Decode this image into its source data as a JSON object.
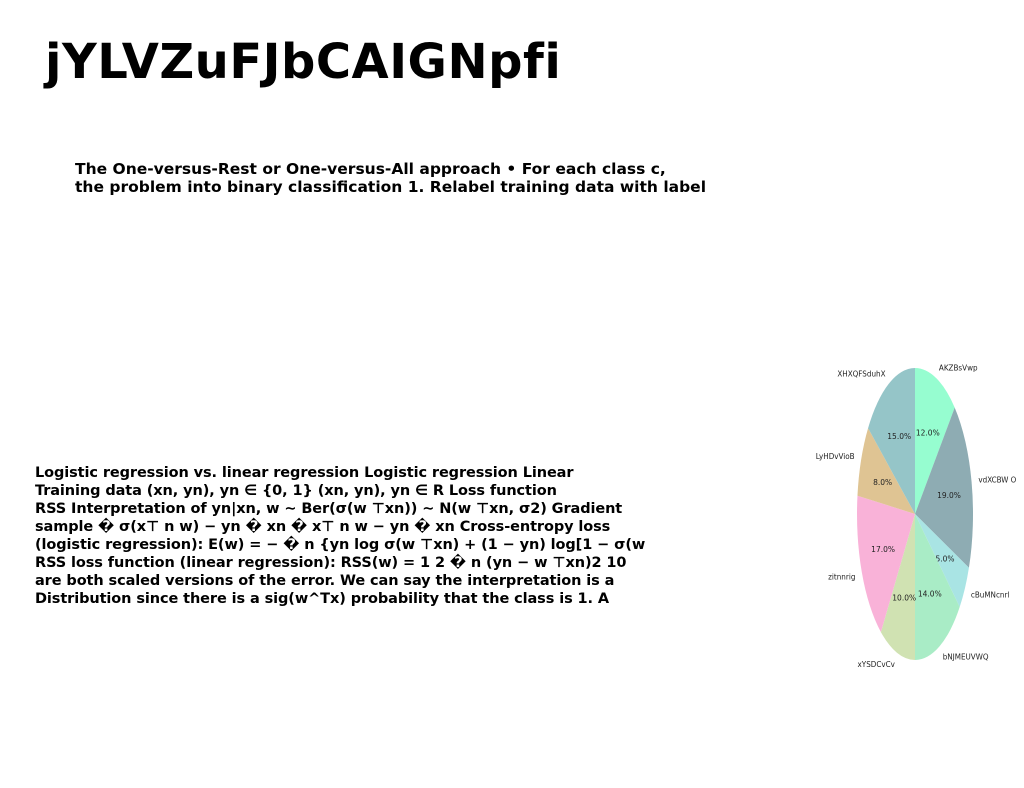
{
  "slide": {
    "title": "jYLVZuFJbCAIGNpfi",
    "intro_lines": [
      "The One-versus-Rest or One-versus-All approach • For each class c,",
      "the problem into binary classification 1. Relabel training data with label"
    ],
    "body_lines": [
      "Logistic regression vs. linear regression Logistic regression Linear",
      "Training data (xn, yn), yn ∈ {0, 1} (xn, yn), yn ∈ R Loss function",
      "RSS Interpretation of yn|xn, w ∼ Ber(σ(w ⊤xn)) ∼ N(w ⊤xn, σ2) Gradient",
      "sample � σ(x⊤ n w) − yn � xn � x⊤ n w − yn � xn Cross-entropy loss",
      "(logistic regression): E(w) = − � n {yn log σ(w ⊤xn) + (1 − yn) log[1 − σ(w",
      "RSS loss function (linear regression): RSS(w) = 1 2 � n (yn − w ⊤xn)2 10",
      "are both scaled versions of the error. We can say the interpretation is a",
      "Distribution since there is a sig(w^Tx) probability that the class is 1. A"
    ]
  },
  "chart_data": {
    "type": "pie",
    "title": "",
    "start_angle_deg": 90,
    "direction": "clockwise",
    "labels": [
      "AKZBsVwp",
      "vdXCBW O",
      "cBuMNcnrl",
      "bNJMEUVWQ",
      "xYSDCvCv",
      "zitnnrig",
      "LyHDvVioB",
      "XHXQFSduhX"
    ],
    "values": [
      12.0,
      19.0,
      5.0,
      14.0,
      10.0,
      17.0,
      8.0,
      15.0
    ],
    "pct_labels": [
      "12.0%",
      "19.0%",
      "5.0%",
      "14.0%",
      "10.0%",
      "17.0%",
      "8.0%",
      "15.0%"
    ],
    "colors": [
      "#96fdd0",
      "#8eacb3",
      "#a9e4e4",
      "#a9ecc6",
      "#d0e2b2",
      "#f9b2d8",
      "#dfc493",
      "#95c5c8"
    ]
  }
}
